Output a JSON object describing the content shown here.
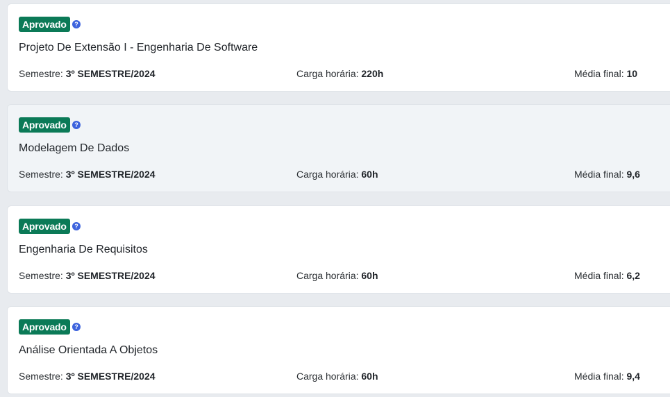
{
  "labels": {
    "semestre": "Semestre:",
    "carga": "Carga horária:",
    "media": "Média final:"
  },
  "help_icon_glyph": "?",
  "colors": {
    "badge_bg": "#0b7a57",
    "help_icon": "#3d63dd"
  },
  "courses": [
    {
      "status": "Aprovado",
      "name": "Projeto De Extensão I - Engenharia De Software",
      "semestre": "3º SEMESTRE/2024",
      "carga": "220h",
      "media": "10"
    },
    {
      "status": "Aprovado",
      "name": "Modelagem De Dados",
      "semestre": "3º SEMESTRE/2024",
      "carga": "60h",
      "media": "9,6"
    },
    {
      "status": "Aprovado",
      "name": "Engenharia De Requisitos",
      "semestre": "3º SEMESTRE/2024",
      "carga": "60h",
      "media": "6,2"
    },
    {
      "status": "Aprovado",
      "name": "Análise Orientada A Objetos",
      "semestre": "3º SEMESTRE/2024",
      "carga": "60h",
      "media": "9,4"
    }
  ]
}
